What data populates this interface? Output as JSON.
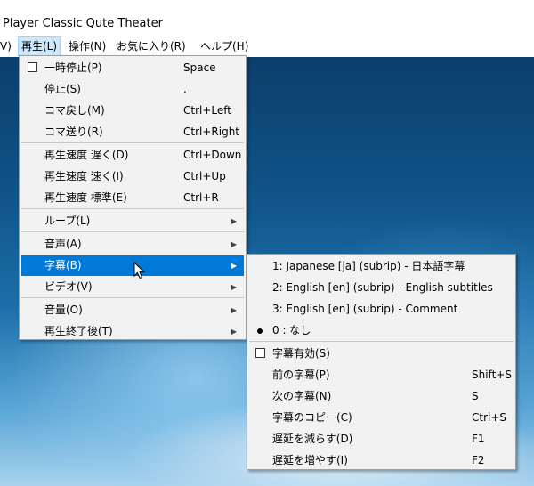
{
  "window": {
    "title": "Player Classic Qute Theater"
  },
  "menubar": [
    {
      "label": "V)"
    },
    {
      "label": "再生(L)"
    },
    {
      "label": "操作(N)"
    },
    {
      "label": "お気に入り(R)"
    },
    {
      "label": "ヘルプ(H)"
    }
  ],
  "play_menu": {
    "items": [
      {
        "label": "一時停止(P)",
        "shortcut": "Space"
      },
      {
        "label": "停止(S)",
        "shortcut": "."
      },
      {
        "label": "コマ戻し(M)",
        "shortcut": "Ctrl+Left"
      },
      {
        "label": "コマ送り(R)",
        "shortcut": "Ctrl+Right"
      },
      {
        "label": "再生速度 遅く(D)",
        "shortcut": "Ctrl+Down"
      },
      {
        "label": "再生速度 速く(I)",
        "shortcut": "Ctrl+Up"
      },
      {
        "label": "再生速度 標準(E)",
        "shortcut": "Ctrl+R"
      },
      {
        "label": "ループ(L)"
      },
      {
        "label": "音声(A)"
      },
      {
        "label": "字幕(B)"
      },
      {
        "label": "ビデオ(V)"
      },
      {
        "label": "音量(O)"
      },
      {
        "label": "再生終了後(T)"
      }
    ]
  },
  "subtitle_menu": {
    "items": [
      {
        "label": "1: Japanese [ja] (subrip) - 日本語字幕"
      },
      {
        "label": "2: English [en] (subrip) - English subtitles"
      },
      {
        "label": "3: English [en] (subrip) - Comment"
      },
      {
        "label": "0 : なし"
      },
      {
        "label": "字幕有効(S)"
      },
      {
        "label": "前の字幕(P)",
        "shortcut": "Shift+S"
      },
      {
        "label": "次の字幕(N)",
        "shortcut": "S"
      },
      {
        "label": "字幕のコピー(C)",
        "shortcut": "Ctrl+S"
      },
      {
        "label": "遅延を減らす(D)",
        "shortcut": "F1"
      },
      {
        "label": "遅延を増やす(I)",
        "shortcut": "F2"
      }
    ]
  }
}
